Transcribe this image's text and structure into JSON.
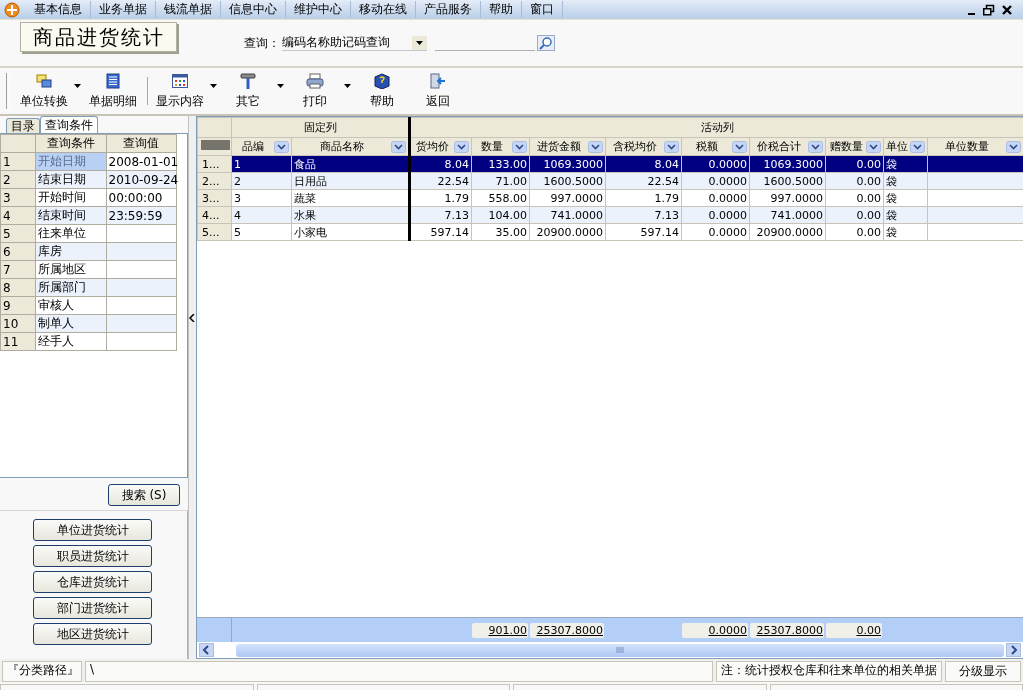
{
  "menu": {
    "items": [
      "基本信息",
      "业务单据",
      "钱流单据",
      "信息中心",
      "维护中心",
      "移动在线",
      "产品服务",
      "帮助",
      "窗口"
    ]
  },
  "header": {
    "title": "商品进货统计",
    "query_label": "查询：",
    "query_mode": "编码名称助记码查询"
  },
  "toolbar": {
    "buttons": [
      {
        "label": "单位转换",
        "kind": "units",
        "dropdown": true
      },
      {
        "label": "单据明细",
        "kind": "list",
        "dropdown": false
      },
      {
        "label": "显示内容",
        "kind": "grid",
        "dropdown": true
      },
      {
        "label": "其它",
        "kind": "hammer",
        "dropdown": true
      },
      {
        "label": "打印",
        "kind": "printer",
        "dropdown": true
      },
      {
        "label": "帮助",
        "kind": "book",
        "dropdown": false
      },
      {
        "label": "返回",
        "kind": "door",
        "dropdown": false
      }
    ]
  },
  "left_panel": {
    "tabs": [
      {
        "label": "目录",
        "selected": false
      },
      {
        "label": "查询条件",
        "selected": true
      }
    ],
    "query_table": {
      "columns": [
        "查询条件",
        "查询值"
      ],
      "rows": [
        {
          "index": "1",
          "condition": "开始日期",
          "value": "2008-01-01",
          "selected": true
        },
        {
          "index": "2",
          "condition": "结束日期",
          "value": "2010-09-24",
          "selected": false
        },
        {
          "index": "3",
          "condition": "开始时间",
          "value": "00:00:00",
          "selected": false
        },
        {
          "index": "4",
          "condition": "结束时间",
          "value": "23:59:59",
          "selected": false
        },
        {
          "index": "5",
          "condition": "往来单位",
          "selected": false
        },
        {
          "index": "6",
          "condition": "库房",
          "selected": false
        },
        {
          "index": "7",
          "condition": "所属地区",
          "selected": false
        },
        {
          "index": "8",
          "condition": "所属部门",
          "selected": false
        },
        {
          "index": "9",
          "condition": "审核人",
          "selected": false
        },
        {
          "index": "10",
          "condition": "制单人",
          "selected": false
        },
        {
          "index": "11",
          "condition": "经手人",
          "selected": false
        }
      ]
    },
    "search_button": "搜索 (S)",
    "stat_buttons": [
      "单位进货统计",
      "职员进货统计",
      "仓库进货统计",
      "部门进货统计",
      "地区进货统计"
    ]
  },
  "grid": {
    "group_headers": [
      "固定列",
      "活动列"
    ],
    "columns": [
      {
        "label": "品编",
        "kind": "text"
      },
      {
        "label": "商品名称",
        "kind": "text"
      },
      {
        "label": "货均价",
        "kind": "number"
      },
      {
        "label": "数量",
        "kind": "number",
        "total": "901.00"
      },
      {
        "label": "进货金额",
        "kind": "number",
        "total": "25307.8000"
      },
      {
        "label": "含税均价",
        "kind": "number"
      },
      {
        "label": "税额",
        "kind": "number",
        "total": "0.0000"
      },
      {
        "label": "价税合计",
        "kind": "number",
        "total": "25307.8000"
      },
      {
        "label": "赠数量",
        "kind": "number",
        "total": "0.00"
      },
      {
        "label": "单位",
        "kind": "text"
      },
      {
        "label": "单位数量",
        "kind": "text"
      }
    ],
    "rows": [
      {
        "header": "1...",
        "selected": true,
        "cells": [
          "1",
          "食品",
          "8.04",
          "133.00",
          "1069.3000",
          "8.04",
          "0.0000",
          "1069.3000",
          "0.00",
          "袋",
          ""
        ]
      },
      {
        "header": "2...",
        "selected": false,
        "cells": [
          "2",
          "日用品",
          "22.54",
          "71.00",
          "1600.5000",
          "22.54",
          "0.0000",
          "1600.5000",
          "0.00",
          "袋",
          ""
        ]
      },
      {
        "header": "3...",
        "selected": false,
        "cells": [
          "3",
          "蔬菜",
          "1.79",
          "558.00",
          "997.0000",
          "1.79",
          "0.0000",
          "997.0000",
          "0.00",
          "袋",
          ""
        ]
      },
      {
        "header": "4...",
        "selected": false,
        "cells": [
          "4",
          "水果",
          "7.13",
          "104.00",
          "741.0000",
          "7.13",
          "0.0000",
          "741.0000",
          "0.00",
          "袋",
          ""
        ]
      },
      {
        "header": "5...",
        "selected": false,
        "cells": [
          "5",
          "小家电",
          "597.14",
          "35.00",
          "20900.0000",
          "597.14",
          "0.0000",
          "20900.0000",
          "0.00",
          "袋",
          ""
        ]
      }
    ]
  },
  "status_bar": {
    "path_label": "『分类路径』",
    "path": "\\",
    "note": "注：统计授权仓库和往来单位的相关单据",
    "level_button": "分级显示"
  }
}
